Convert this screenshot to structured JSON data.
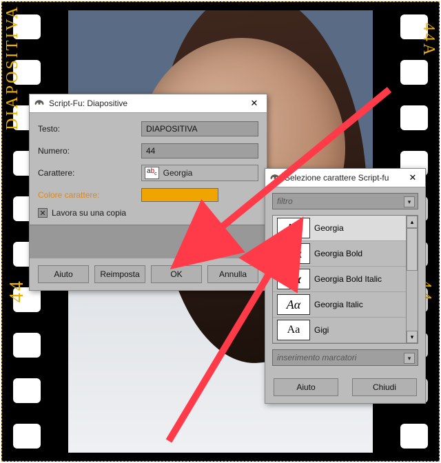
{
  "film": {
    "title_text": "DIAPOSITIVA",
    "num_text": "44",
    "numA_text": "44A"
  },
  "dlg1": {
    "title": "Script-Fu: Diapositive",
    "labels": {
      "testo": "Testo:",
      "numero": "Numero:",
      "carattere": "Carattere:",
      "colore": "Colore carattere:"
    },
    "values": {
      "testo": "DIAPOSITIVA",
      "numero": "44",
      "font": "Georgia",
      "color": "#f0a400"
    },
    "copy_label": "Lavora su una copia",
    "buttons": {
      "aiuto": "Aiuto",
      "reimposta": "Reimposta",
      "ok": "OK",
      "annulla": "Annulla"
    }
  },
  "dlg2": {
    "title": "Selezione carattere Script-fu",
    "filter_placeholder": "filtro",
    "fonts": [
      {
        "name": "Georgia",
        "sample": "Aα",
        "style": ""
      },
      {
        "name": "Georgia Bold",
        "sample": "Aα",
        "style": "b"
      },
      {
        "name": "Georgia Bold Italic",
        "sample": "Aα",
        "style": "b i"
      },
      {
        "name": "Georgia Italic",
        "sample": "Aα",
        "style": "i"
      },
      {
        "name": "Gigi",
        "sample": "Aa",
        "style": "gigi"
      }
    ],
    "marker_placeholder": "inserimento marcatori",
    "buttons": {
      "aiuto": "Aiuto",
      "chiudi": "Chiudi"
    }
  }
}
